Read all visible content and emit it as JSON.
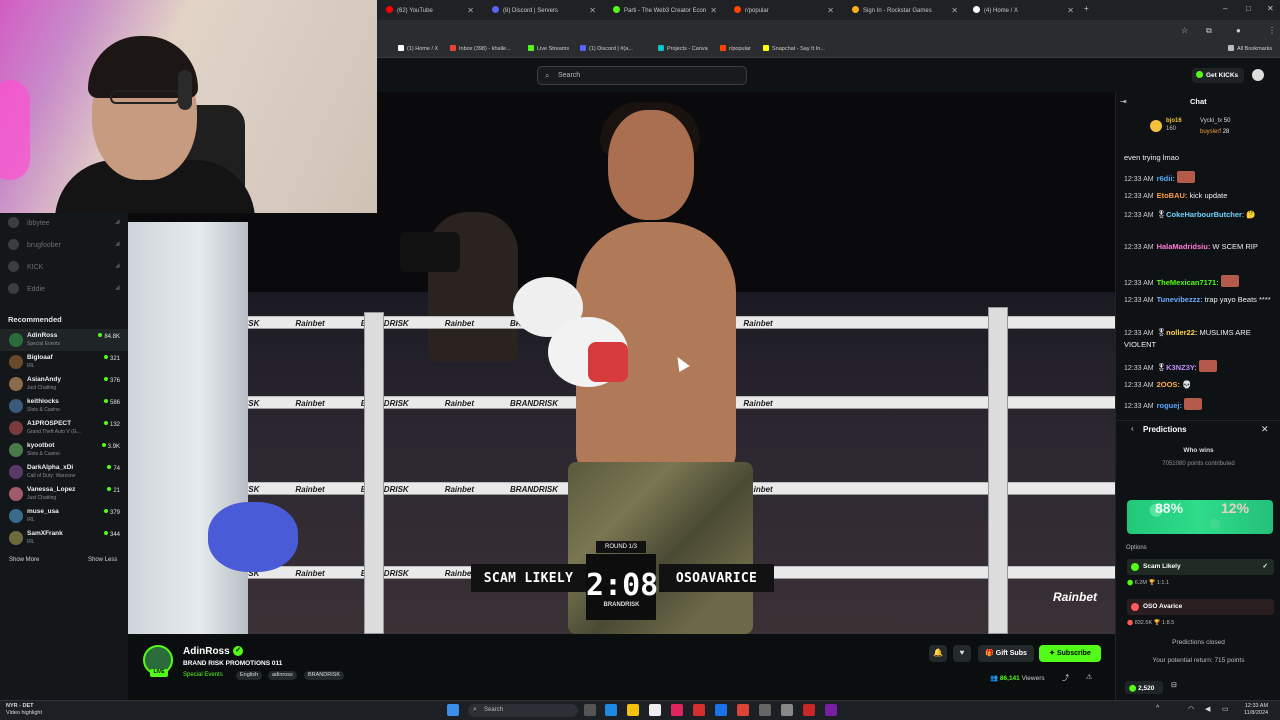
{
  "browser": {
    "tabs": [
      {
        "label": "(62) YouTube",
        "color": "#ff0000"
      },
      {
        "label": "(8) Discord | Servers",
        "color": "#5865f2"
      },
      {
        "label": "Parti - The Web3 Creator Econ",
        "color": "#53fc18"
      },
      {
        "label": "r/popular",
        "color": "#ff4500"
      },
      {
        "label": "Sign In - Rockstar Games",
        "color": "#fcaf17"
      },
      {
        "label": "(4) Home / X",
        "color": "#ffffff"
      }
    ],
    "bookmarks": [
      "(1) Home / X",
      "Inbox (398) - khalle...",
      "Live Streams",
      "(1) Discord | #(a...",
      "Projects - Canva",
      "r/popular",
      "Snapchat - Say It In..."
    ],
    "all_bookmarks": "All Bookmarks"
  },
  "header": {
    "search_placeholder": "Search",
    "get_kicks": "Get KICKs"
  },
  "sidebar": {
    "followed": [
      "ibbytee",
      "brugfoober",
      "KICK",
      "Eddie"
    ],
    "recommended_title": "Recommended",
    "recommended": [
      {
        "name": "AdinRoss",
        "category": "Special Events",
        "viewers": "84.8K",
        "color": "#2c6b3a"
      },
      {
        "name": "Bigloaaf",
        "category": "IRL",
        "viewers": "321",
        "color": "#6b4a2a"
      },
      {
        "name": "AsianAndy",
        "category": "Just Chatting",
        "viewers": "376",
        "color": "#8a6a4a"
      },
      {
        "name": "keithlocks",
        "category": "Slots & Casino",
        "viewers": "586",
        "color": "#3a5a7a"
      },
      {
        "name": "A1PROSPECT",
        "category": "Grand Theft Auto V (G...",
        "viewers": "132",
        "color": "#7a3a3a"
      },
      {
        "name": "kyootbot",
        "category": "Slots & Casino",
        "viewers": "3.9K",
        "color": "#4a7a4a"
      },
      {
        "name": "DarkAlpha_xDi",
        "category": "Call of Duty: Warzone",
        "viewers": "74",
        "color": "#5a3a6a"
      },
      {
        "name": "Vanessa_Lopez",
        "category": "Just Chatting",
        "viewers": "21",
        "color": "#a05a6a"
      },
      {
        "name": "muse_usa",
        "category": "IRL",
        "viewers": "379",
        "color": "#3a6a8a"
      },
      {
        "name": "SamXFrank",
        "category": "IRL",
        "viewers": "344",
        "color": "#6a6a3a"
      }
    ],
    "show_more": "Show More",
    "show_less": "Show Less"
  },
  "video": {
    "rope_text": "Rainbet",
    "rope_text_2": "BRANDRISK",
    "round": "ROUND 1/3",
    "fighter_left": "SCAM LIKELY",
    "clock": "2:08",
    "fighter_right": "OSOAVARICE",
    "promo": "BRANDRISK",
    "watermark": "Rainbet"
  },
  "channel": {
    "name": "AdinRoss",
    "live_badge": "LIVE",
    "verified": "✓",
    "title": "BRAND RISK PROMOTIONS 011",
    "category": "Special Events",
    "tags": [
      "English",
      "adinross",
      "BRANDRISK"
    ],
    "gift_subs": "Gift Subs",
    "subscribe": "Subscribe",
    "viewers": "86,141",
    "viewers_label": "Viewers"
  },
  "chat": {
    "title": "Chat",
    "pinned": [
      {
        "user": "bjo16",
        "value": "160",
        "color": "#f3c23c"
      },
      {
        "user": "Vycki_tx",
        "value": "50",
        "color": "#cfcfcf"
      },
      {
        "user": "buyslerf",
        "value": "28",
        "color": "#f39a3c"
      }
    ],
    "messages": [
      {
        "time": "",
        "user": "",
        "text": "even trying lmao",
        "color": "#efefef"
      },
      {
        "time": "12:33 AM",
        "user": "r6dii:",
        "text": "",
        "color": "#5aa7ff"
      },
      {
        "time": "12:33 AM",
        "user": "EtoBAU:",
        "text": " kick update",
        "color": "#ff9a3c"
      },
      {
        "time": "12:33 AM",
        "user": "CokeHarbourButcher",
        "text": ": 🤔",
        "color": "#6ed3ff"
      },
      {
        "time": "12:33 AM",
        "user": "HalaMadridsiu:",
        "text": " W SCEM RIP",
        "color": "#ff7ad9"
      },
      {
        "time": "12:33 AM",
        "user": "TheMexican7171:",
        "text": "",
        "color": "#53fc18"
      },
      {
        "time": "12:33 AM",
        "user": "Tunevibezzz:",
        "text": " trap yayo Beats ****",
        "color": "#6ea8ff"
      },
      {
        "time": "12:33 AM",
        "user": "noller22:",
        "text": " MUSLIMS ARE VIOLENT",
        "color": "#ffd24a"
      },
      {
        "time": "12:33 AM",
        "user": "K3NZ3Y:",
        "text": "",
        "color": "#c38cff"
      },
      {
        "time": "12:33 AM",
        "user": "2OOS:",
        "text": " 💀",
        "color": "#ffb04a"
      },
      {
        "time": "12:33 AM",
        "user": "roguej:",
        "text": "",
        "color": "#5aa7ff"
      }
    ]
  },
  "predictions": {
    "title": "Predictions",
    "question": "Who wins",
    "points": "7051080 points contributed",
    "pct_left": "88%",
    "pct_right": "12%",
    "options_label": "Options",
    "option1": {
      "name": "Scam Likely",
      "points": "6.2M",
      "ratio": "1:1.1",
      "color": "#53fc18"
    },
    "option2": {
      "name": "OSO Avarice",
      "points": "832.5K",
      "ratio": "1:8.5",
      "color": "#ff5b5b"
    },
    "closed": "Predictions closed",
    "return": "Your potential return: 715 points",
    "kicks": "2,520"
  },
  "taskbar": {
    "team": "NYR - DET",
    "sub": "Video highlight",
    "search": "Search",
    "time": "12:33 AM",
    "date": "11/8/2024"
  }
}
